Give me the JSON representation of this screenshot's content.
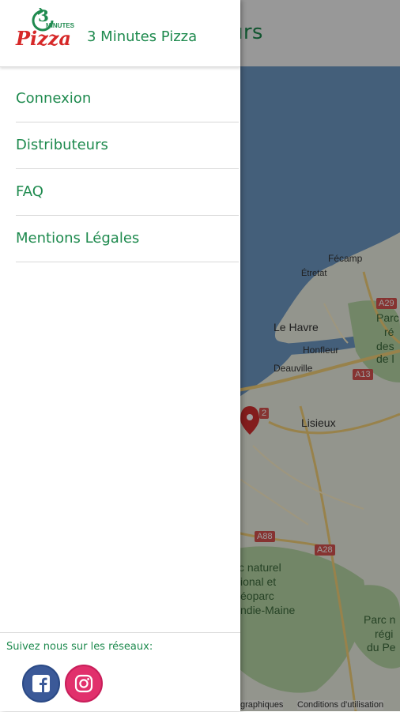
{
  "appbar": {
    "title": "Distributeurs"
  },
  "drawer": {
    "app_name": "3 Minutes Pizza",
    "logo": {
      "number": "3",
      "minutes": "MINUTES",
      "pizza": "Pizza"
    },
    "menu": [
      {
        "label": "Connexion"
      },
      {
        "label": "Distributeurs"
      },
      {
        "label": "FAQ"
      },
      {
        "label": "Mentions Légales"
      }
    ],
    "social": {
      "label": "Suivez nous sur les réseaux:",
      "facebook_icon": "facebook-icon",
      "instagram_icon": "instagram-icon"
    }
  },
  "map": {
    "places": {
      "fecamp": "Fécamp",
      "etretat": "Étretat",
      "le_havre": "Le Havre",
      "honfleur": "Honfleur",
      "deauville": "Deauville",
      "lisieux": "Lisieux",
      "parc_1a": "Parc",
      "parc_1b": "ré",
      "parc_1c": "des",
      "parc_1d": "de l",
      "parc_2a": "c naturel",
      "parc_2b": "ional et",
      "parc_2c": "éoparc",
      "parc_2d": "ndie-Maine",
      "parc_3a": "Parc n",
      "parc_3b": "régi",
      "parc_3c": "du Pe"
    },
    "roads": {
      "a29": "A29",
      "a13": "A13",
      "a28": "A28",
      "a88": "A88",
      "r2": "2"
    },
    "footer": {
      "data": "graphiques",
      "terms": "Conditions d'utilisation"
    },
    "colors": {
      "water": "#6f9ac6",
      "land": "#eef1e4",
      "forest": "#b9d8a6",
      "road": "#f6d27a",
      "marker": "#d32f2f"
    }
  },
  "colors": {
    "accent": "#1e8a4e",
    "facebook": "#3b5998",
    "instagram": "#e1306c"
  }
}
